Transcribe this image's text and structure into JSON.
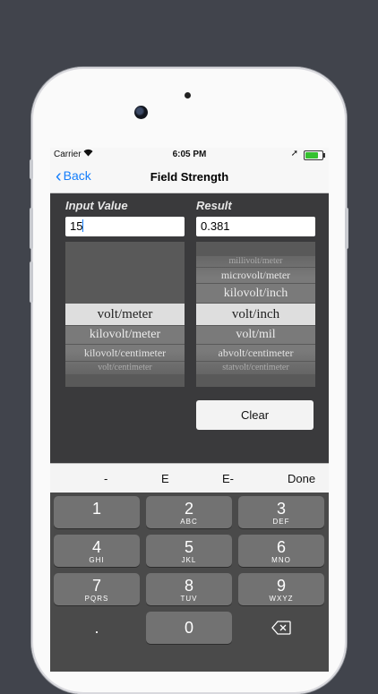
{
  "status": {
    "carrier": "Carrier",
    "time": "6:05 PM"
  },
  "nav": {
    "back_label": "Back",
    "title": "Field Strength"
  },
  "input": {
    "label": "Input Value",
    "value": "15"
  },
  "result": {
    "label": "Result",
    "value": "0.381"
  },
  "input_picker": {
    "items": [
      "volt/meter",
      "kilovolt/meter",
      "kilovolt/centimeter",
      "volt/centimeter"
    ],
    "selected": "volt/meter"
  },
  "result_picker": {
    "items": [
      "millivolt/meter",
      "microvolt/meter",
      "kilovolt/inch",
      "volt/inch",
      "volt/mil",
      "abvolt/centimeter",
      "statvolt/centimeter"
    ],
    "selected": "volt/inch"
  },
  "clear_label": "Clear",
  "accessory": {
    "minus": "-",
    "e": "E",
    "e_minus": "E-",
    "done": "Done"
  },
  "keys": [
    {
      "num": "1",
      "sub": ""
    },
    {
      "num": "2",
      "sub": "ABC"
    },
    {
      "num": "3",
      "sub": "DEF"
    },
    {
      "num": "4",
      "sub": "GHI"
    },
    {
      "num": "5",
      "sub": "JKL"
    },
    {
      "num": "6",
      "sub": "MNO"
    },
    {
      "num": "7",
      "sub": "PQRS"
    },
    {
      "num": "8",
      "sub": "TUV"
    },
    {
      "num": "9",
      "sub": "WXYZ"
    }
  ],
  "bottom_keys": {
    "dot": ".",
    "zero": "0"
  }
}
